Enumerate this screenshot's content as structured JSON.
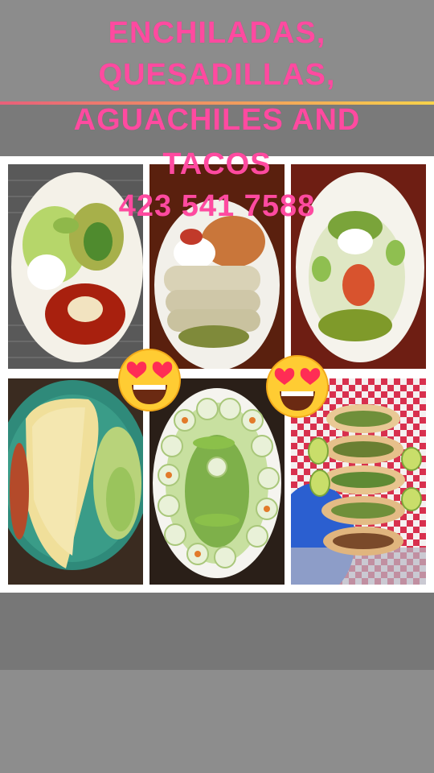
{
  "poster": {
    "line1": "ENCHILADAS,",
    "line2": "QUESADILLAS,",
    "line3": "AGUACHILES AND",
    "line4": "TACOS",
    "phone": "423 541 7588"
  },
  "colors": {
    "headline": "#ff4aa0",
    "background": "#8a8a8a",
    "panel": "#ffffff"
  },
  "icons": [
    "heart-eyes-emoji-icon",
    "heart-eyes-emoji-icon"
  ]
}
